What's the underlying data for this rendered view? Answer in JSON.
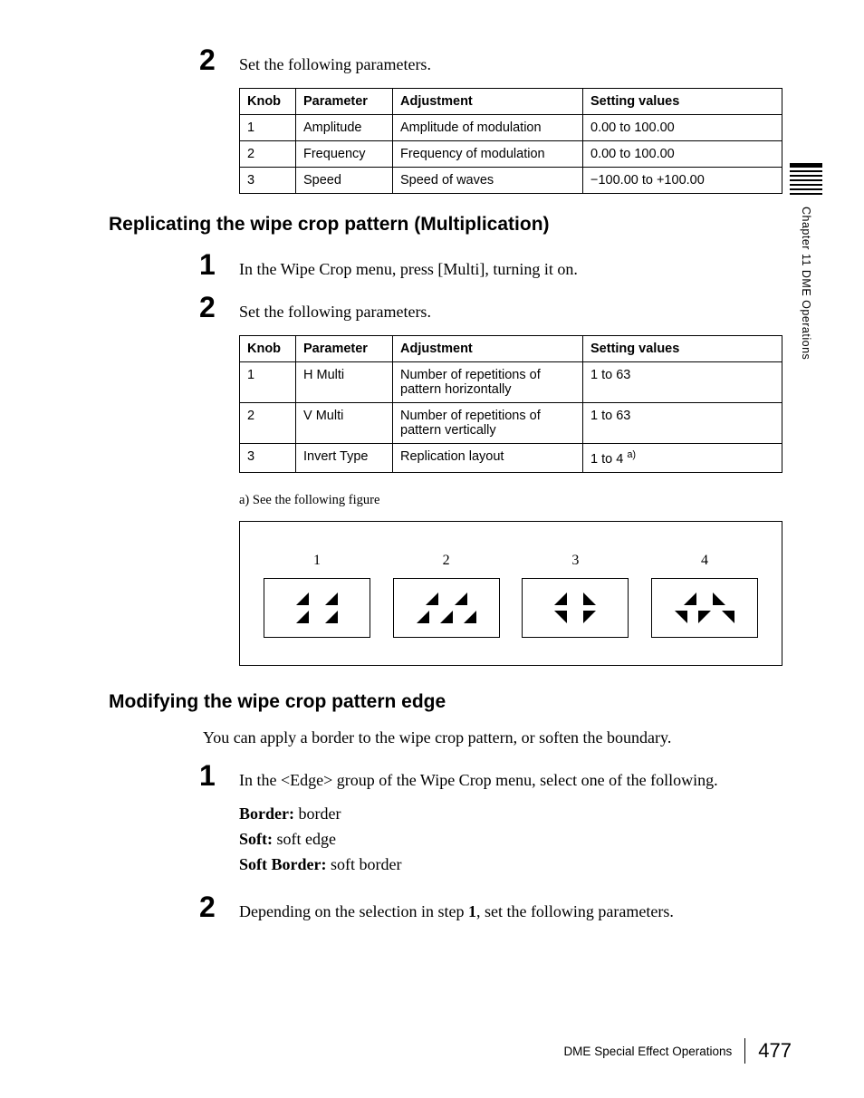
{
  "sidebar": {
    "chapter": "Chapter 11  DME Operations"
  },
  "footer": {
    "section": "DME Special Effect Operations",
    "page": "477"
  },
  "step_a": {
    "num": "2",
    "text": "Set the following parameters."
  },
  "table1": {
    "headers": {
      "knob": "Knob",
      "param": "Parameter",
      "adj": "Adjustment",
      "vals": "Setting values"
    },
    "rows": [
      {
        "knob": "1",
        "param": "Amplitude",
        "adj": "Amplitude of modulation",
        "vals": "0.00 to 100.00"
      },
      {
        "knob": "2",
        "param": "Frequency",
        "adj": "Frequency of modulation",
        "vals": "0.00 to 100.00"
      },
      {
        "knob": "3",
        "param": "Speed",
        "adj": "Speed of waves",
        "vals": "−100.00 to +100.00"
      }
    ]
  },
  "heading1": "Replicating the wipe crop pattern (Multiplication)",
  "step_b1": {
    "num": "1",
    "text": "In the Wipe Crop menu, press [Multi], turning it on."
  },
  "step_b2": {
    "num": "2",
    "text": "Set the following parameters."
  },
  "table2": {
    "headers": {
      "knob": "Knob",
      "param": "Parameter",
      "adj": "Adjustment",
      "vals": "Setting values"
    },
    "rows": [
      {
        "knob": "1",
        "param": "H Multi",
        "adj": "Number of repetitions of pattern horizontally",
        "vals": "1 to 63"
      },
      {
        "knob": "2",
        "param": "V Multi",
        "adj": "Number of repetitions of pattern vertically",
        "vals": "1 to 63"
      },
      {
        "knob": "3",
        "param": "Invert Type",
        "adj": "Replication layout",
        "vals": "1 to 4",
        "sup": "a)"
      }
    ]
  },
  "footnote": "a) See the following figure",
  "figure": {
    "labels": [
      "1",
      "2",
      "3",
      "4"
    ]
  },
  "heading2": "Modifying the wipe crop pattern edge",
  "body2": "You can apply a border to the wipe crop pattern, or soften the boundary.",
  "step_c1": {
    "num": "1",
    "text": "In the <Edge> group of the Wipe Crop menu, select one of the following.",
    "options": [
      {
        "label": "Border:",
        "value": " border"
      },
      {
        "label": "Soft:",
        "value": " soft edge"
      },
      {
        "label": "Soft Border:",
        "value": " soft border"
      }
    ]
  },
  "step_c2": {
    "num": "2",
    "pre": "Depending on the selection in step ",
    "bold": "1",
    "post": ", set the following parameters."
  }
}
